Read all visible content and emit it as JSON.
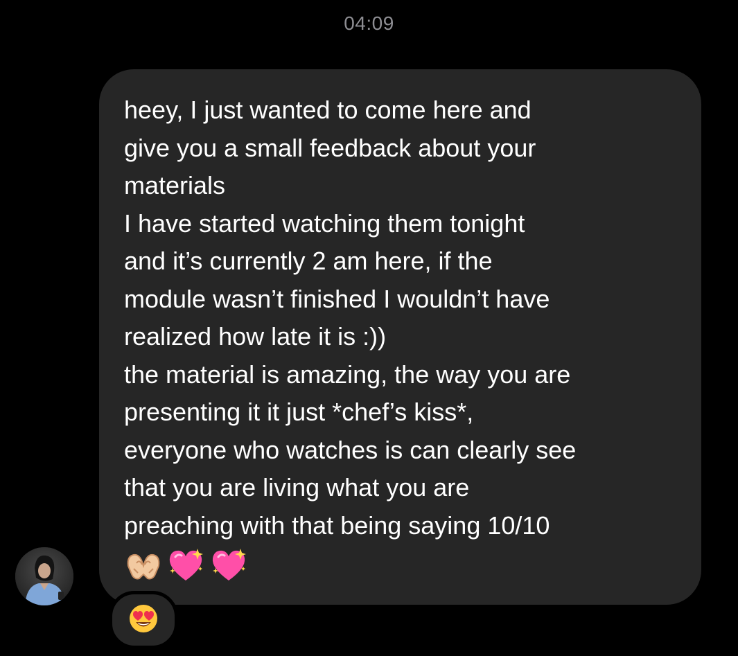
{
  "timestamp": "04:09",
  "message": {
    "paragraphs": [
      "heey, I just wanted to come here and\ngive you a small feedback about your\nmaterials",
      "I have started watching them tonight\nand it’s currently 2 am here, if the\nmodule wasn’t finished I wouldn’t have\nrealized how late it is :))",
      "the material is amazing, the way you are\npresenting it it just *chef’s kiss*,\neveryone who watches is can clearly see\nthat you are living what you are\npreaching with that being saying 10/10"
    ],
    "emojis": [
      "heart-hands-icon",
      "sparkling-heart-icon",
      "sparkling-heart-icon"
    ]
  },
  "reaction": {
    "emoji": "heart-eyes-face-icon"
  },
  "colors": {
    "background": "#000000",
    "bubble": "#262626",
    "timestamp": "#8e8e93",
    "text": "#ffffff"
  }
}
